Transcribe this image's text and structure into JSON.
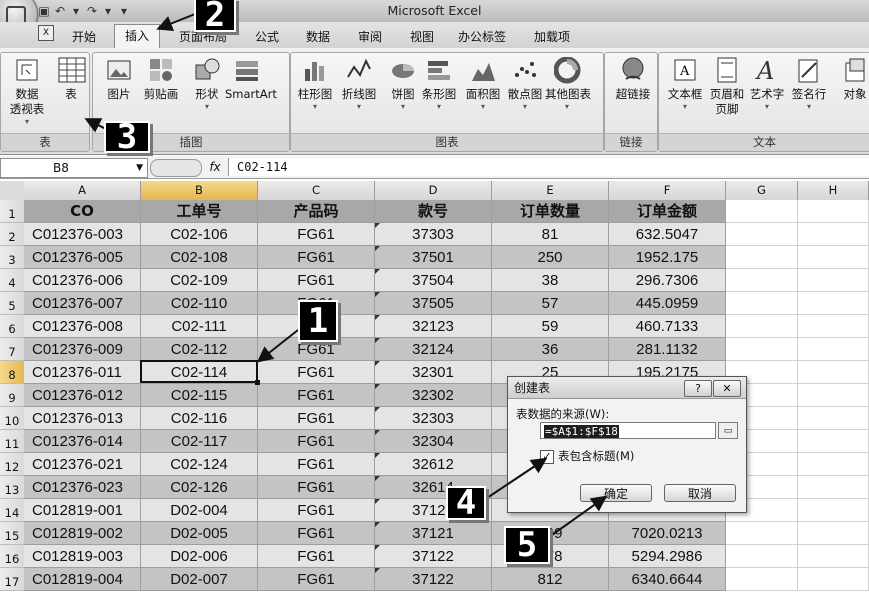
{
  "app_title": "Microsoft Excel",
  "qat": {
    "save": "▣",
    "undo": "↶",
    "undo_caret": "▾",
    "redo": "↷",
    "redo_caret": "▾",
    "customize": "▾"
  },
  "tabs": [
    "开始",
    "插入",
    "页面布局",
    "公式",
    "数据",
    "审阅",
    "视图",
    "办公标签",
    "加载项"
  ],
  "active_tab": "插入",
  "ribbon": {
    "groups": [
      {
        "label": "表",
        "buttons": [
          {
            "label": "数据\n透视表",
            "icon": "pivot-table-icon",
            "dropdown": true
          },
          {
            "label": "表",
            "icon": "table-icon",
            "dropdown": false
          }
        ]
      },
      {
        "label": "插图",
        "buttons": [
          {
            "label": "图片",
            "icon": "picture-icon",
            "dropdown": false
          },
          {
            "label": "剪贴画",
            "icon": "clip-art-icon",
            "dropdown": false
          },
          {
            "label": "形状",
            "icon": "shapes-icon",
            "dropdown": true
          },
          {
            "label": "SmartArt",
            "icon": "smartart-icon",
            "dropdown": false
          }
        ]
      },
      {
        "label": "图表",
        "buttons": [
          {
            "label": "柱形图",
            "icon": "column-chart-icon",
            "dropdown": true
          },
          {
            "label": "折线图",
            "icon": "line-chart-icon",
            "dropdown": true
          },
          {
            "label": "饼图",
            "icon": "pie-chart-icon",
            "dropdown": true
          },
          {
            "label": "条形图",
            "icon": "bar-chart-icon",
            "dropdown": true
          },
          {
            "label": "面积图",
            "icon": "area-chart-icon",
            "dropdown": true
          },
          {
            "label": "散点图",
            "icon": "scatter-chart-icon",
            "dropdown": true
          },
          {
            "label": "其他图表",
            "icon": "other-charts-icon",
            "dropdown": true
          }
        ]
      },
      {
        "label": "链接",
        "buttons": [
          {
            "label": "超链接",
            "icon": "hyperlink-icon",
            "dropdown": false
          }
        ]
      },
      {
        "label": "文本",
        "buttons": [
          {
            "label": "文本框",
            "icon": "text-box-icon",
            "dropdown": true
          },
          {
            "label": "页眉和\n页脚",
            "icon": "header-footer-icon",
            "dropdown": false
          },
          {
            "label": "艺术字",
            "icon": "wordart-icon",
            "dropdown": true
          },
          {
            "label": "签名行",
            "icon": "signature-line-icon",
            "dropdown": true
          },
          {
            "label": "对象",
            "icon": "object-icon",
            "dropdown": false
          }
        ]
      }
    ]
  },
  "formula_bar": {
    "name_box": "B8",
    "fx": "fx",
    "content": "C02-114"
  },
  "columns": [
    "A",
    "B",
    "C",
    "D",
    "E",
    "F",
    "G",
    "H"
  ],
  "rows": [
    "1",
    "2",
    "3",
    "4",
    "5",
    "6",
    "7",
    "8",
    "9",
    "10",
    "11",
    "12",
    "13",
    "14",
    "15",
    "16",
    "17"
  ],
  "table_header": [
    "CO",
    "工单号",
    "产品码",
    "款号",
    "订单数量",
    "订单金额"
  ],
  "table_rows": [
    [
      "C012376-003",
      "C02-106",
      "FG61",
      "37303",
      "81",
      "632.5047"
    ],
    [
      "C012376-005",
      "C02-108",
      "FG61",
      "37501",
      "250",
      "1952.175"
    ],
    [
      "C012376-006",
      "C02-109",
      "FG61",
      "37504",
      "38",
      "296.7306"
    ],
    [
      "C012376-007",
      "C02-110",
      "FG61",
      "37505",
      "57",
      "445.0959"
    ],
    [
      "C012376-008",
      "C02-111",
      "FG61",
      "32123",
      "59",
      "460.7133"
    ],
    [
      "C012376-009",
      "C02-112",
      "FG61",
      "32124",
      "36",
      "281.1132"
    ],
    [
      "C012376-011",
      "C02-114",
      "FG61",
      "32301",
      "25",
      "195.2175"
    ],
    [
      "C012376-012",
      "C02-115",
      "FG61",
      "32302",
      "",
      ""
    ],
    [
      "C012376-013",
      "C02-116",
      "FG61",
      "32303",
      "",
      ""
    ],
    [
      "C012376-014",
      "C02-117",
      "FG61",
      "32304",
      "",
      ""
    ],
    [
      "C012376-021",
      "C02-124",
      "FG61",
      "32612",
      "",
      ""
    ],
    [
      "C012376-023",
      "C02-126",
      "FG61",
      "32614",
      "",
      ""
    ],
    [
      "C012819-001",
      "D02-004",
      "FG61",
      "37121",
      "",
      ""
    ],
    [
      "C012819-002",
      "D02-005",
      "FG61",
      "37121",
      "899",
      "7020.0213"
    ],
    [
      "C012819-003",
      "D02-006",
      "FG61",
      "37122",
      "678",
      "5294.2986"
    ],
    [
      "C012819-004",
      "D02-007",
      "FG61",
      "37122",
      "812",
      "6340.6644"
    ]
  ],
  "dialog": {
    "title": "创建表",
    "help": "?",
    "close": "✕",
    "source_label": "表数据的来源(W):",
    "range": "=$A$1:$F$18",
    "has_headers_label": "表包含标题(M)",
    "has_headers": true,
    "ok": "确定",
    "cancel": "取消"
  },
  "callouts": [
    "1",
    "2",
    "3",
    "4",
    "5"
  ]
}
